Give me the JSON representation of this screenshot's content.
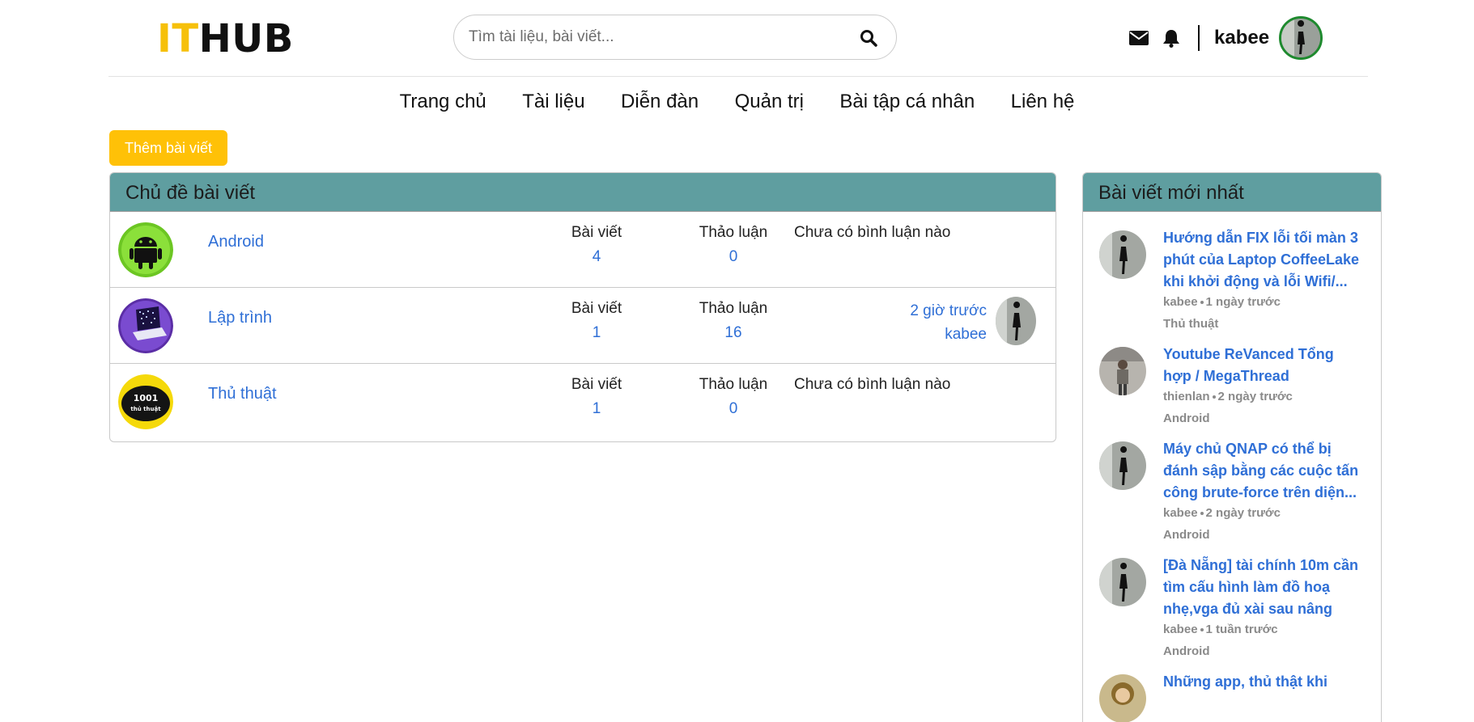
{
  "header": {
    "logo_it": "IT",
    "logo_hub": "HUB",
    "search_placeholder": "Tìm tài liệu, bài viết...",
    "username": "kabee"
  },
  "nav": {
    "items": [
      "Trang chủ",
      "Tài liệu",
      "Diễn đàn",
      "Quản trị",
      "Bài tập cá nhân",
      "Liên hệ"
    ]
  },
  "actions": {
    "add_post": "Thêm bài viết"
  },
  "topics": {
    "title": "Chủ đề bài viết",
    "posts_label": "Bài viết",
    "discussions_label": "Thảo luận",
    "rows": [
      {
        "name": "Android",
        "posts": "4",
        "discussions": "0",
        "last": "Chưa có bình luận nào"
      },
      {
        "name": "Lập trình",
        "posts": "1",
        "discussions": "16",
        "last_time": "2 giờ trước",
        "last_user": "kabee"
      },
      {
        "name": "Thủ thuật",
        "posts": "1",
        "discussions": "0",
        "last": "Chưa có bình luận nào"
      }
    ]
  },
  "latest": {
    "title": "Bài viết mới nhất",
    "posts": [
      {
        "title": "Hướng dẫn FIX lỗi tối màn 3 phút của Laptop CoffeeLake khi khởi động và lỗi Wifi/...",
        "author": "kabee",
        "time": "1 ngày trước",
        "category": "Thủ thuật"
      },
      {
        "title": "Youtube ReVanced Tổng hợp / MegaThread",
        "author": "thienlan",
        "time": "2 ngày trước",
        "category": "Android"
      },
      {
        "title": "Máy chủ QNAP có thể bị đánh sập bằng các cuộc tấn công brute-force trên diện...",
        "author": "kabee",
        "time": "2 ngày trước",
        "category": "Android"
      },
      {
        "title": "[Đà Nẵng] tài chính 10m cần tìm cấu hình làm đồ hoạ nhẹ,vga đủ xài sau nâng cấ...",
        "author": "kabee",
        "time": "1 tuần trước",
        "category": "Android"
      },
      {
        "title": "Những app, thủ thật khi",
        "author": "",
        "time": "",
        "category": ""
      }
    ]
  },
  "colors": {
    "accent": "#ffc107",
    "card_header": "#5f9ea0",
    "link": "#2f6fd6"
  }
}
